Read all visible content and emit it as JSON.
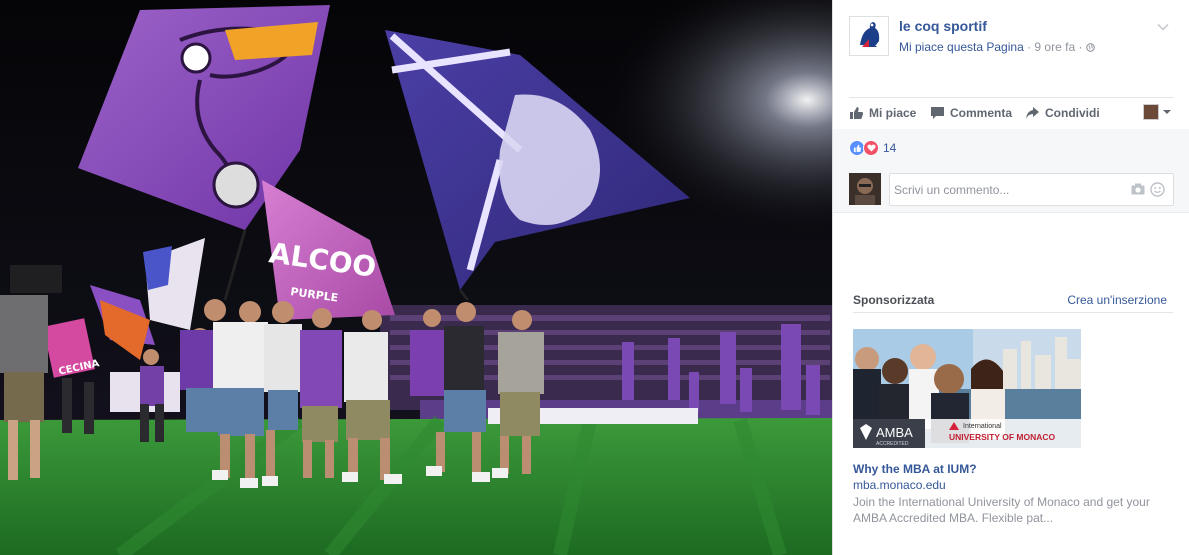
{
  "post": {
    "page_name": "le coq sportif",
    "like_page": "Mi piace questa Pagina",
    "separator": " · ",
    "time": "9 ore fa",
    "audience_icon": "globe-icon"
  },
  "actions": {
    "like": "Mi piace",
    "comment": "Commenta",
    "share": "Condividi"
  },
  "reactions": {
    "count": "14",
    "icons": [
      "like-reaction-icon",
      "love-reaction-icon"
    ]
  },
  "comment_box": {
    "placeholder": "Scrivi un commento..."
  },
  "sponsored": {
    "title": "Sponsorizzata",
    "create_ad": "Crea un'inserzione"
  },
  "ad": {
    "title": "Why the MBA at IUM?",
    "url": "mba.monaco.edu",
    "description": "Join the International University of Monaco and get your AMBA Accredited MBA. Flexible pat...",
    "image_badge_left": "AMBA",
    "image_badge_left_sub": "ACCREDITED",
    "image_badge_right_top": "International",
    "image_badge_right": "UNIVERSITY OF MONACO"
  },
  "colors": {
    "link": "#365899",
    "brand_blue": "#1d3f8a",
    "brand_red": "#d6213a",
    "like_blue": "#5890ff",
    "love_red": "#f25268",
    "flag_purple": "#7b3fb0"
  },
  "photo": {
    "banner_text": "ALCOO",
    "banner_sub": "PURPLE",
    "ad_board_text": "CECINA"
  }
}
